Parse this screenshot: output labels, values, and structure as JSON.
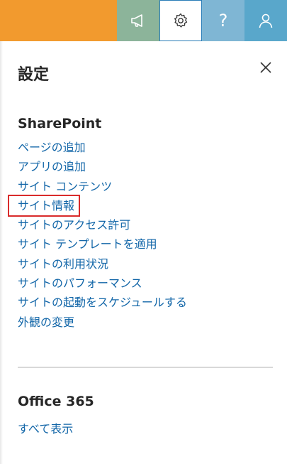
{
  "topbar": {
    "help_label": "?",
    "icons": [
      "megaphone-icon",
      "gear-icon",
      "help-icon",
      "user-icon"
    ],
    "colors": {
      "bar": "#f29a2e",
      "megaphone": "#8cb49a",
      "gear": "#ffffff",
      "help": "#7fb6d4",
      "user": "#59a7cb"
    }
  },
  "panel": {
    "title": "設定",
    "close_icon": "close-icon"
  },
  "sharepoint": {
    "title": "SharePoint",
    "links": [
      "ページの追加",
      "アプリの追加",
      "サイト コンテンツ",
      "サイト情報",
      "サイトのアクセス許可",
      "サイト テンプレートを適用",
      "サイトの利用状況",
      "サイトのパフォーマンス",
      "サイトの起動をスケジュールする",
      "外観の変更"
    ],
    "highlighted_link": "サイト情報"
  },
  "office": {
    "title": "Office 365",
    "show_all": "すべて表示"
  },
  "colors": {
    "link": "#1266a8",
    "highlight_border": "#d92b2b"
  }
}
